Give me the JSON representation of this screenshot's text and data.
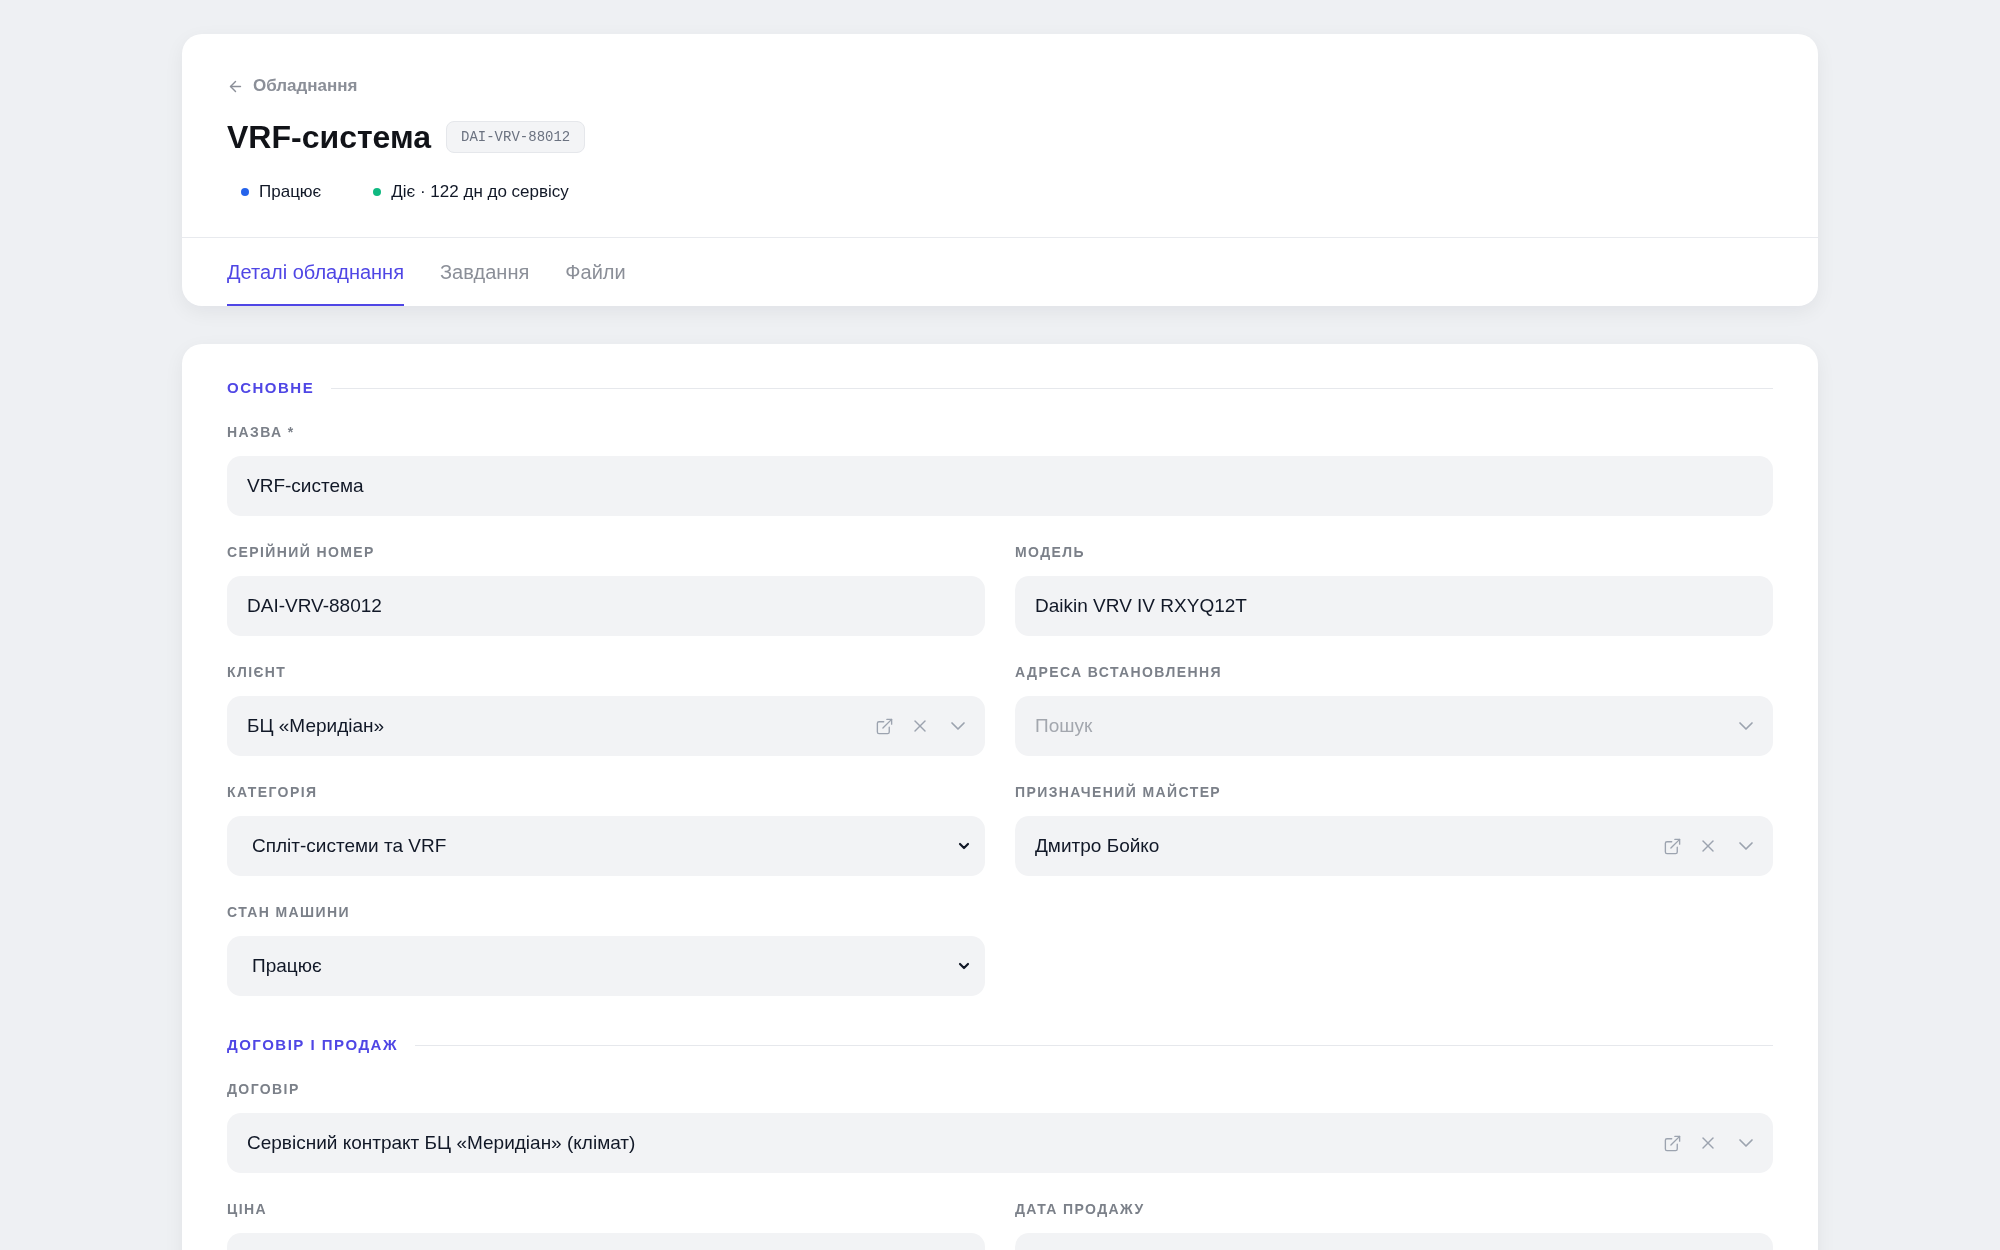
{
  "back_link": {
    "label": "Обладнання"
  },
  "title": "VRF-система",
  "code_badge": "DAI-VRV-88012",
  "statuses": [
    {
      "label": "Працює",
      "color": "#2563eb"
    },
    {
      "label": "Діє · 122 дн до сервісу",
      "color": "#10b981"
    }
  ],
  "tabs": [
    {
      "label": "Деталі обладнання",
      "selected": true
    },
    {
      "label": "Завдання",
      "selected": false
    },
    {
      "label": "Файли",
      "selected": false
    }
  ],
  "sections": [
    {
      "title": "ОСНОВНЕ",
      "fields": [
        {
          "label": "НАЗВА *",
          "kind": "text",
          "value": "VRF-система",
          "wide": true
        },
        {
          "label": "СЕРІЙНИЙ НОМЕР",
          "kind": "text",
          "value": "DAI-VRV-88012"
        },
        {
          "label": "МОДЕЛЬ",
          "kind": "text",
          "value": "Daikin VRV IV RXYQ12T"
        },
        {
          "label": "КЛІЄНТ",
          "kind": "combobox",
          "value": "БЦ «Меридіан»"
        },
        {
          "label": "АДРЕСА ВСТАНОВЛЕННЯ",
          "kind": "combobox",
          "placeholder": "Пошук"
        },
        {
          "label": "КАТЕГОРІЯ",
          "kind": "select",
          "value": "Спліт-системи та VRF"
        },
        {
          "label": "ПРИЗНАЧЕНИЙ МАЙСТЕР",
          "kind": "combobox",
          "value": "Дмитро Бойко"
        },
        {
          "label": "СТАН МАШИНИ",
          "kind": "select",
          "value": "Працює"
        }
      ]
    },
    {
      "title": "ДОГОВІР І ПРОДАЖ",
      "fields": [
        {
          "label": "ДОГОВІР",
          "kind": "combobox",
          "value": "Сервісний контракт БЦ «Меридіан» (клімат)",
          "wide": true
        },
        {
          "label": "ЦІНА",
          "kind": "text"
        },
        {
          "label": "ДАТА ПРОДАЖУ",
          "kind": "text"
        }
      ]
    }
  ]
}
